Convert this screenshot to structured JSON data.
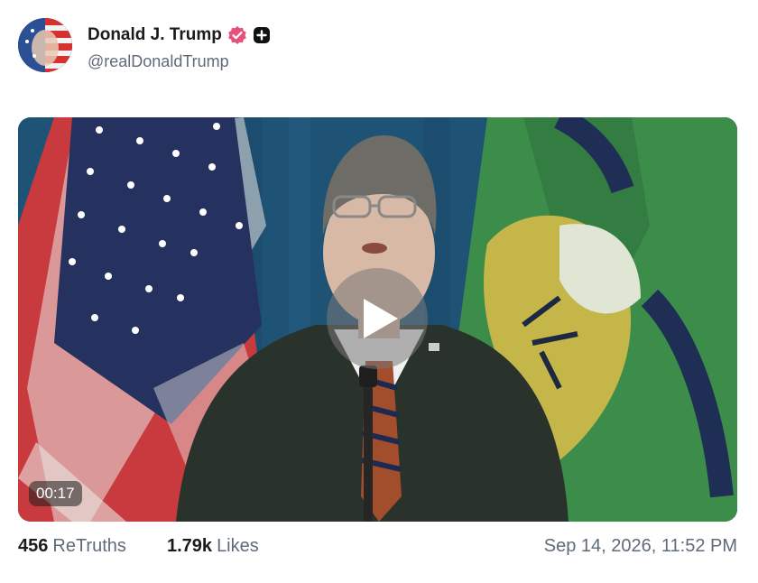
{
  "post": {
    "author": {
      "display_name": "Donald J. Trump",
      "handle": "@realDonaldTrump",
      "verified_icon": "verified-badge-icon",
      "extra_icon": "plus-badge-icon"
    },
    "media": {
      "type": "video",
      "duration": "00:17",
      "play_icon": "play-icon"
    },
    "stats": {
      "retruths_count": "456",
      "retruths_label": "ReTruths",
      "likes_count": "1.79k",
      "likes_label": "Likes"
    },
    "timestamp": "Sep 14, 2026, 11:52 PM"
  },
  "colors": {
    "verified": "#e8507a",
    "muted_text": "#5f6b7a",
    "name_text": "#1b1b1f"
  }
}
